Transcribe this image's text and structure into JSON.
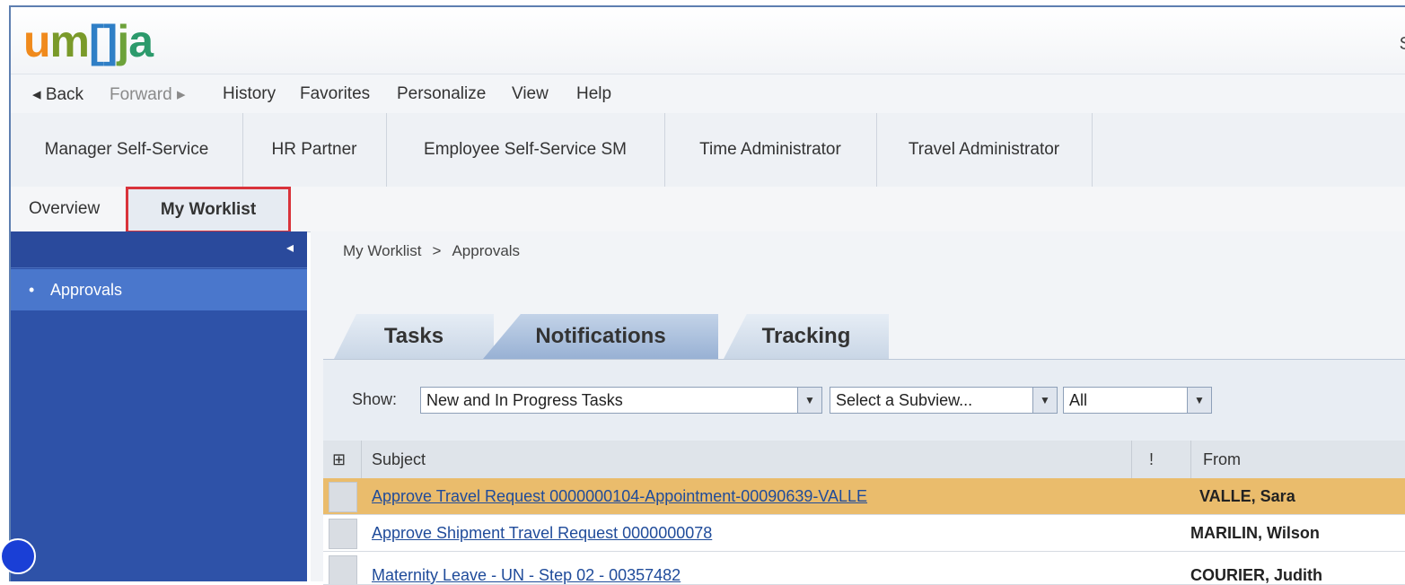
{
  "logo": {
    "u": "u",
    "m": "m",
    "o": "[]",
    "j": "j",
    "a": "a"
  },
  "header": {
    "user_initial": "S"
  },
  "toolbar": {
    "back": "◂ Back",
    "forward": "Forward ▸",
    "history": "History",
    "favorites": "Favorites",
    "personalize": "Personalize",
    "view": "View",
    "help": "Help"
  },
  "roles": [
    "Manager Self-Service",
    "HR Partner",
    "Employee Self-Service SM",
    "Time Administrator",
    "Travel Administrator"
  ],
  "subtabs": {
    "overview": "Overview",
    "worklist": "My Worklist"
  },
  "nav": {
    "items": [
      {
        "bullet": "•",
        "label": "Approvals"
      }
    ],
    "collapse": "◂"
  },
  "breadcrumb": {
    "root": "My Worklist",
    "sep": ">",
    "current": "Approvals"
  },
  "worklist_tabs": [
    "Tasks",
    "Notifications",
    "Tracking"
  ],
  "filters": {
    "show_label": "Show:",
    "status_value": "New and In Progress Tasks",
    "subview_value": "Select a Subview...",
    "scope_value": "All",
    "arrow": "▼"
  },
  "table": {
    "settings_icon": "⊞",
    "headers": {
      "subject": "Subject",
      "priority": "!",
      "from": "From"
    },
    "rows": [
      {
        "subject": "Approve Travel Request 0000000104-Appointment-00090639-VALLE",
        "from": "VALLE, Sara",
        "selected": true
      },
      {
        "subject": "Approve Shipment Travel Request 0000000078",
        "from": "MARILIN, Wilson",
        "selected": false
      },
      {
        "subject": "Maternity Leave - UN - Step 02 - 00357482",
        "from": "COURIER, Judith",
        "selected": false
      }
    ]
  },
  "colors": {
    "nav_blue": "#2e52a8",
    "highlight_row": "#eabc6c",
    "focus_border": "#d9333b"
  }
}
